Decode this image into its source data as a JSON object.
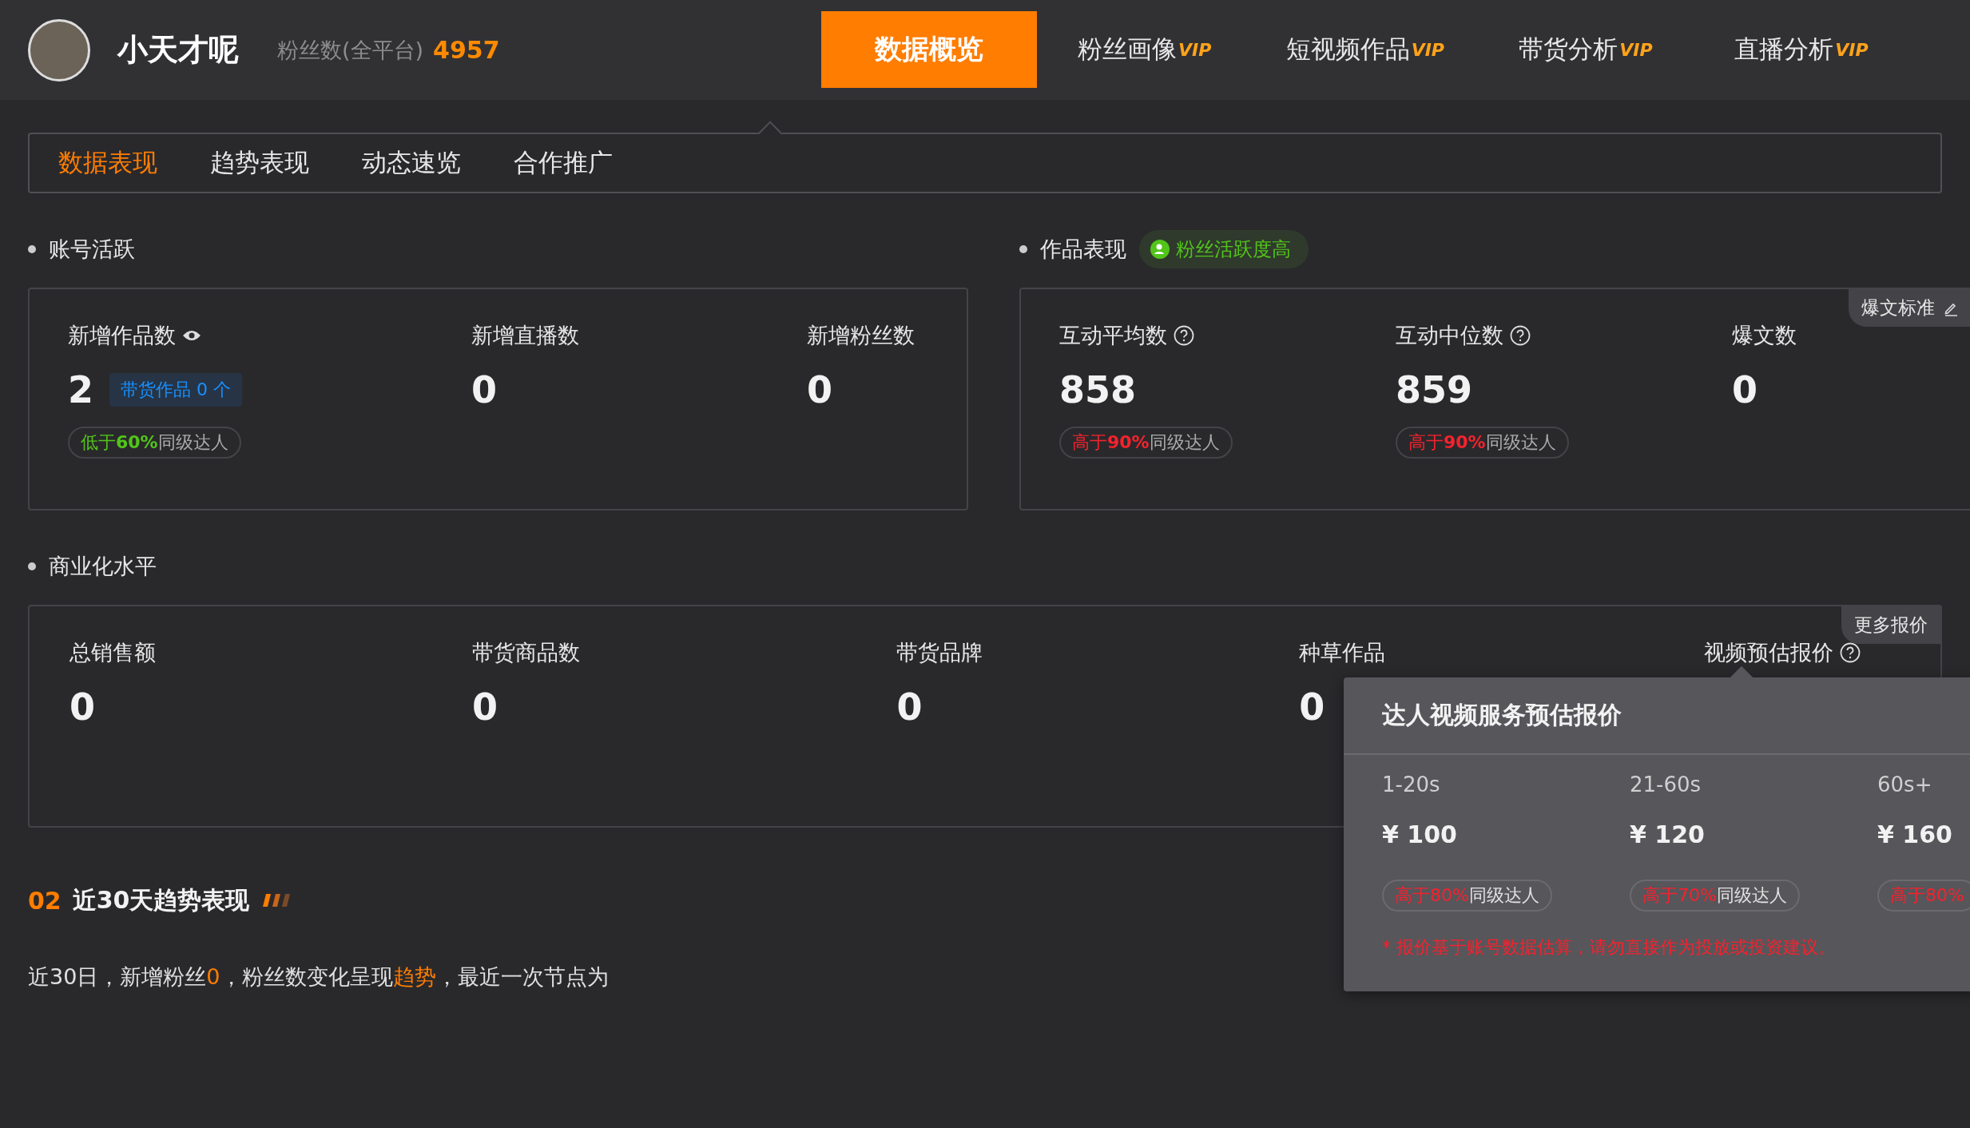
{
  "header": {
    "name": "小天才呢",
    "fans_label": "粉丝数(全平台)",
    "fans_count": "4957",
    "nav": [
      {
        "label": "数据概览",
        "selected": true
      },
      {
        "label": "粉丝画像",
        "badge": "VIP",
        "selected": false
      },
      {
        "label": "短视频作品",
        "badge": "VIP",
        "selected": false
      },
      {
        "label": "带货分析",
        "badge": "VIP",
        "selected": false
      },
      {
        "label": "直播分析",
        "badge": "VIP",
        "selected": false
      }
    ]
  },
  "subtabs": [
    {
      "label": "数据表现",
      "selected": true
    },
    {
      "label": "趋势表现",
      "selected": false
    },
    {
      "label": "动态速览",
      "selected": false
    },
    {
      "label": "合作推广",
      "selected": false
    }
  ],
  "account_activity": {
    "title": "账号活跃",
    "metrics": [
      {
        "label": "新增作品数",
        "kind": "eye",
        "value": "2",
        "chip": "带货作品 0 个",
        "tag": {
          "color": "#52c41a",
          "lead": "低于**60%**",
          "rest": "同级达人"
        }
      },
      {
        "label": "新增直播数",
        "value": "0"
      },
      {
        "label": "新增粉丝数",
        "value": "0"
      }
    ]
  },
  "work_performance": {
    "title": "作品表现",
    "badge": "粉丝活跃度高",
    "corner_button": "爆文标准",
    "metrics": [
      {
        "label": "互动平均数",
        "kind": "help",
        "value": "858",
        "tag": {
          "color": "#f5222d",
          "lead": "高于**90%**",
          "rest": "同级达人"
        }
      },
      {
        "label": "互动中位数",
        "kind": "help",
        "value": "859",
        "tag": {
          "color": "#f5222d",
          "lead": "高于**90%**",
          "rest": "同级达人"
        }
      },
      {
        "label": "爆文数",
        "value": "0"
      }
    ]
  },
  "commercial": {
    "title": "商业化水平",
    "corner_button": "更多报价",
    "metrics": [
      {
        "label": "总销售额",
        "value": "0"
      },
      {
        "label": "带货商品数",
        "value": "0"
      },
      {
        "label": "带货品牌",
        "value": "0"
      },
      {
        "label": "种草作品",
        "value": "0"
      },
      {
        "label": "视频预估报价",
        "kind": "help"
      }
    ]
  },
  "quote_popup": {
    "title": "达人视频服务预估报价",
    "columns": [
      {
        "duration": "1-20s",
        "price": "¥ 100",
        "tag": {
          "color": "#f5222d",
          "lead": "高于80%",
          "rest": "同级达人"
        }
      },
      {
        "duration": "21-60s",
        "price": "¥ 120",
        "tag": {
          "color": "#f5222d",
          "lead": "高于70%",
          "rest": "同级达人"
        }
      },
      {
        "duration": "60s+",
        "price": "¥ 160",
        "tag": {
          "color": "#f5222d",
          "lead": "高于80%"
        }
      }
    ],
    "note": "* 报价基于账号数据估算，请勿直接作为投放或投资建议。"
  },
  "trend": {
    "number": "02",
    "title": "近30天趋势表现",
    "summary": [
      {
        "text": "近30日，新增粉丝",
        "highlight": false
      },
      {
        "text": "0",
        "highlight": true
      },
      {
        "text": "，粉丝数变化呈现",
        "highlight": false
      },
      {
        "text": "趋势",
        "highlight": true
      },
      {
        "text": "，最近一次节点为",
        "highlight": false
      }
    ]
  }
}
